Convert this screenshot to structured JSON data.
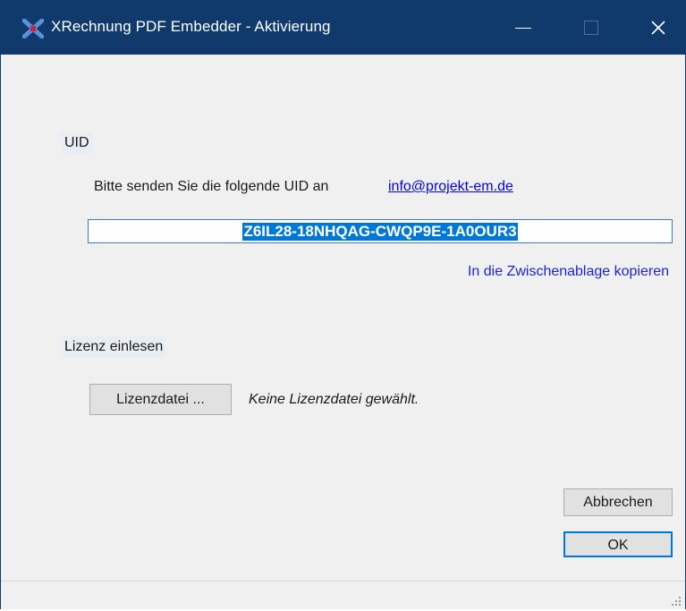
{
  "window": {
    "title": "XRechnung PDF Embedder - Aktivierung",
    "icons": {
      "app": "xrechnung-app-icon",
      "minimize": "minimize-icon",
      "maximize": "maximize-icon",
      "close": "close-icon"
    }
  },
  "uid_section": {
    "label": "UID",
    "instruction": "Bitte senden Sie die folgende UID an",
    "email": "info@projekt-em.de",
    "uid_value": "Z6IL28-18NHQAG-CWQP9E-1A0OUR3",
    "copy_link": "In die Zwischenablage kopieren"
  },
  "license_section": {
    "label": "Lizenz einlesen",
    "file_button": "Lizenzdatei ...",
    "status": "Keine Lizenzdatei gewählt."
  },
  "buttons": {
    "cancel": "Abbrechen",
    "ok": "OK"
  },
  "colors": {
    "titlebar": "#0f3a6b",
    "selection": "#0078d7",
    "link": "#0000ee",
    "background": "#f0f0f0"
  }
}
